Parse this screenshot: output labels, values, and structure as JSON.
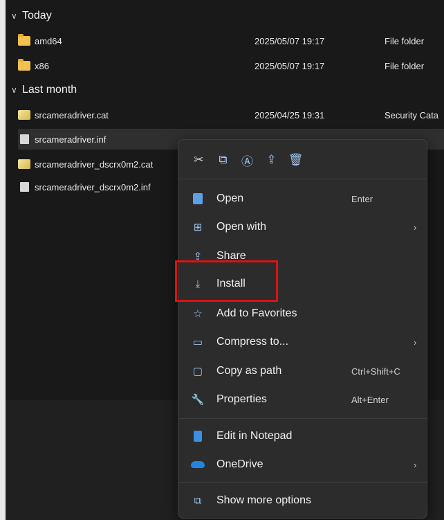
{
  "file_list": {
    "groups": [
      {
        "header": "Today"
      },
      {
        "header": "Last month"
      }
    ],
    "rows": [
      {
        "name": "amd64",
        "date": "2025/05/07 19:17",
        "type": "File folder",
        "icon": "folder-icon"
      },
      {
        "name": "x86",
        "date": "2025/05/07 19:17",
        "type": "File folder",
        "icon": "folder-icon"
      },
      {
        "name": "srcameradriver.cat",
        "date": "2025/04/25 19:31",
        "type": "Security Cata",
        "icon": "security-catalog-icon"
      },
      {
        "name": "srcameradriver.inf",
        "date": "",
        "type": "",
        "icon": "setup-info-icon"
      },
      {
        "name": "srcameradriver_dscrx0m2.cat",
        "date": "",
        "type": "",
        "icon": "security-catalog-icon"
      },
      {
        "name": "srcameradriver_dscrx0m2.inf",
        "date": "",
        "type": "",
        "icon": "setup-info-icon"
      }
    ]
  },
  "context_menu": {
    "quick_actions": [
      {
        "icon": "cut-icon",
        "glyph": "✂"
      },
      {
        "icon": "copy-icon",
        "glyph": "⧉"
      },
      {
        "icon": "rename-icon",
        "glyph": "Ⓐ"
      },
      {
        "icon": "share-icon",
        "glyph": "⇪"
      },
      {
        "icon": "delete-icon",
        "glyph": "🗑"
      }
    ],
    "items": [
      {
        "label": "Open",
        "shortcut": "Enter",
        "icon": "open-icon"
      },
      {
        "label": "Open with",
        "arrow": "›",
        "icon": "open-with-icon"
      },
      {
        "label": "Share",
        "icon": "share-icon"
      },
      {
        "label": "Install",
        "icon": "install-icon"
      },
      {
        "label": "Add to Favorites",
        "icon": "star-icon"
      },
      {
        "label": "Compress to...",
        "arrow": "›",
        "icon": "compress-icon"
      },
      {
        "label": "Copy as path",
        "shortcut": "Ctrl+Shift+C",
        "icon": "copy-path-icon"
      },
      {
        "label": "Properties",
        "shortcut": "Alt+Enter",
        "icon": "properties-icon"
      },
      {
        "label": "Edit in Notepad",
        "icon": "notepad-icon"
      },
      {
        "label": "OneDrive",
        "arrow": "›",
        "icon": "onedrive-icon"
      },
      {
        "label": "Show more options",
        "icon": "more-options-icon"
      }
    ]
  },
  "colors": {
    "highlight_box": "#e01010",
    "accent": "#9fc6f0"
  }
}
